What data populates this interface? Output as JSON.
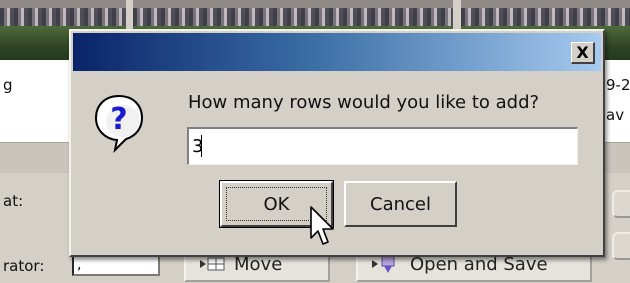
{
  "background": {
    "cells_row1": [
      "g",
      "9-2",
      "av"
    ],
    "field_labels": [
      "at:",
      "rator:"
    ],
    "small_input_value": ",",
    "buttons": [
      {
        "label": "Move",
        "icon": "move-rows-icon"
      },
      {
        "label": "Open and Save",
        "icon": "open-save-icon"
      }
    ]
  },
  "dialog": {
    "title": "",
    "close_label": "X",
    "icon": "question-icon",
    "prompt": "How many rows would you like to add?",
    "input_value": "3",
    "ok_label": "OK",
    "cancel_label": "Cancel"
  },
  "colors": {
    "titlebar_start": "#0a246a",
    "titlebar_end": "#a6caf0",
    "dialog_face": "#d4d0c8",
    "icon_blue": "#1a1ad0"
  }
}
